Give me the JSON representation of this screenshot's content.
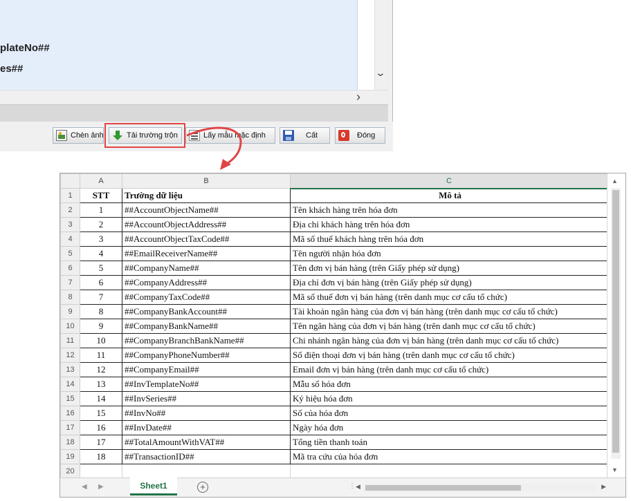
{
  "dialog": {
    "editor_lines": [
      "plateNo##",
      "es##"
    ],
    "buttons": {
      "insert_image": "Chèn ảnh",
      "load_merge_fields": "Tải trường trộn",
      "get_default_template": "Lấy mẫu mặc định",
      "save": "Cất",
      "close": "Đóng"
    }
  },
  "sheet": {
    "columns": [
      "A",
      "B",
      "C"
    ],
    "selected_column": "C",
    "header": {
      "stt": "STT",
      "field": "Trường dữ liệu",
      "description": "Mô tả"
    },
    "rows": [
      {
        "stt": "1",
        "field": "##AccountObjectName##",
        "description": "Tên khách hàng trên hóa đơn"
      },
      {
        "stt": "2",
        "field": "##AccountObjectAddress##",
        "description": "Địa chỉ khách hàng trên hóa đơn"
      },
      {
        "stt": "3",
        "field": "##AccountObjectTaxCode##",
        "description": "Mã số thuế khách hàng trên hóa đơn"
      },
      {
        "stt": "4",
        "field": "##EmailReceiverName##",
        "description": "Tên người nhận hóa đơn"
      },
      {
        "stt": "5",
        "field": "##CompanyName##",
        "description": "Tên đơn vị bán hàng (trên Giấy phép sử dụng)"
      },
      {
        "stt": "6",
        "field": "##CompanyAddress##",
        "description": "Địa chỉ đơn vị bán hàng  (trên Giấy phép sử dụng)"
      },
      {
        "stt": "7",
        "field": "##CompanyTaxCode##",
        "description": "Mã số thuế đơn vị bán hàng  (trên danh mục cơ cấu tổ chức)"
      },
      {
        "stt": "8",
        "field": "##CompanyBankAccount##",
        "description": "Tài khoản ngân hàng của đơn vị bán hàng (trên danh mục cơ cấu tổ chức)"
      },
      {
        "stt": "9",
        "field": "##CompanyBankName##",
        "description": "Tên ngân hàng của đơn vị bán hàng  (trên danh mục cơ cấu tổ chức)"
      },
      {
        "stt": "10",
        "field": "##CompanyBranchBankName##",
        "description": "Chi nhánh ngân hàng của đơn vị bán hàng  (trên danh mục cơ cấu tổ chức)"
      },
      {
        "stt": "11",
        "field": "##CompanyPhoneNumber##",
        "description": "Số điện thoại đơn vị bán hàng (trên danh mục cơ cấu tổ chức)"
      },
      {
        "stt": "12",
        "field": "##CompanyEmail##",
        "description": "Email đơn vị bán hàng  (trên danh mục cơ cấu tổ chức)"
      },
      {
        "stt": "13",
        "field": "##InvTemplateNo##",
        "description": "Mẫu số hóa đơn"
      },
      {
        "stt": "14",
        "field": "##InvSeries##",
        "description": "Ký hiệu hóa đơn"
      },
      {
        "stt": "15",
        "field": "##InvNo##",
        "description": "Số của hóa đơn"
      },
      {
        "stt": "16",
        "field": "##InvDate##",
        "description": "Ngày hóa đơn"
      },
      {
        "stt": "17",
        "field": "##TotalAmountWithVAT##",
        "description": "Tổng tiền thanh toán"
      },
      {
        "stt": "18",
        "field": "##TransactionID##",
        "description": "Mã tra cứu của hóa đơn"
      }
    ],
    "tab_name": "Sheet1"
  }
}
